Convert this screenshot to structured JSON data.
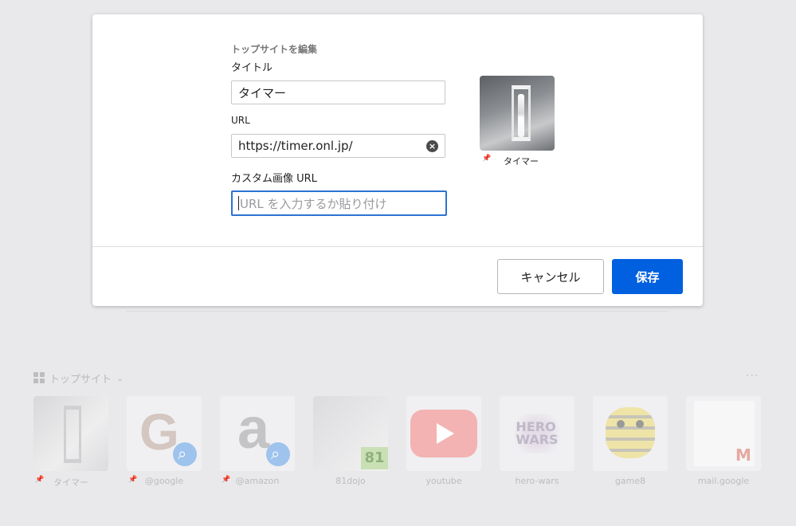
{
  "dialog": {
    "title": "トップサイトを編集",
    "title_label": "タイトル",
    "title_value": "タイマー",
    "url_label": "URL",
    "url_value": "https://timer.onl.jp/",
    "custom_image_label": "カスタム画像 URL",
    "custom_image_placeholder": "URL を入力するか貼り付け",
    "preview_label": "タイマー",
    "cancel_label": "キャンセル",
    "save_label": "保存"
  },
  "top_sites": {
    "header": "トップサイト",
    "chevron": "⌄",
    "more": "···",
    "tiles": [
      {
        "label": "タイマー",
        "icon": "hourglass-photo",
        "pinned": true
      },
      {
        "label": "@google",
        "icon": "google-search",
        "pinned": true
      },
      {
        "label": "@amazon",
        "icon": "amazon-search",
        "pinned": true
      },
      {
        "label": "81dojo",
        "icon": "screenshot-thumbnail",
        "pinned": false
      },
      {
        "label": "youtube",
        "icon": "youtube-logo",
        "pinned": false
      },
      {
        "label": "hero-wars",
        "icon": "hero-wars-logo",
        "pinned": false
      },
      {
        "label": "game8",
        "icon": "bee-logo",
        "pinned": false
      },
      {
        "label": "mail.google",
        "icon": "gmail-thumbnail",
        "pinned": false
      }
    ]
  },
  "colors": {
    "primary_button": "#0060df",
    "focus_ring": "#2c73d2",
    "backdrop": "#e9e9eb"
  }
}
